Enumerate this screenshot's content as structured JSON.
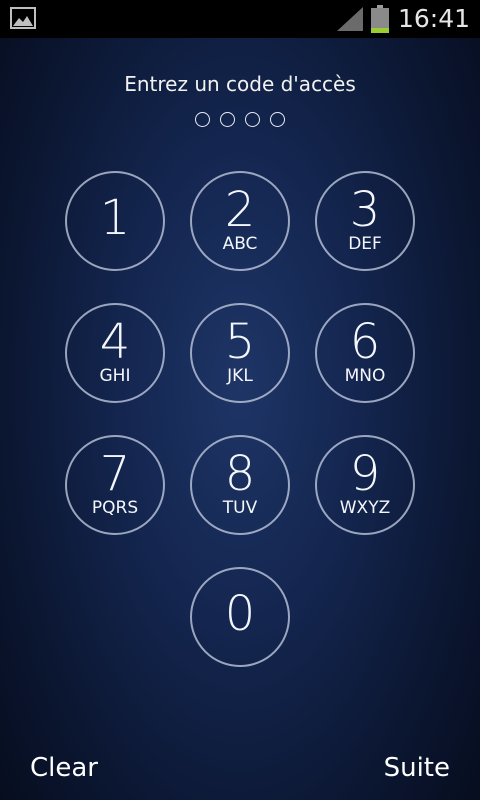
{
  "status_bar": {
    "time": "16:41",
    "notification_icon": "gallery-icon",
    "signal_icon": "signal-icon",
    "battery_icon": "battery-icon"
  },
  "lock": {
    "prompt": "Entrez un code d'accès",
    "code_length": 4,
    "entered": 0
  },
  "keypad": [
    {
      "digit": "1",
      "letters": ""
    },
    {
      "digit": "2",
      "letters": "ABC"
    },
    {
      "digit": "3",
      "letters": "DEF"
    },
    {
      "digit": "4",
      "letters": "GHI"
    },
    {
      "digit": "5",
      "letters": "JKL"
    },
    {
      "digit": "6",
      "letters": "MNO"
    },
    {
      "digit": "7",
      "letters": "PQRS"
    },
    {
      "digit": "8",
      "letters": "TUV"
    },
    {
      "digit": "9",
      "letters": "WXYZ"
    },
    {
      "digit": "0",
      "letters": ""
    }
  ],
  "footer": {
    "clear_label": "Clear",
    "next_label": "Suite"
  },
  "colors": {
    "background": "#142650",
    "key_border": "#c8d2e6",
    "text": "#ffffff",
    "battery_level": "#9acd32"
  }
}
